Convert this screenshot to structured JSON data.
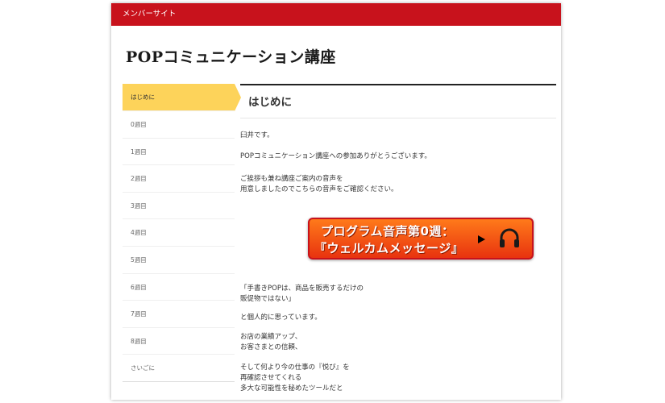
{
  "topbar": {
    "label": "メンバーサイト"
  },
  "site": {
    "title": "POPコミュニケーション講座"
  },
  "sidebar": {
    "items": [
      {
        "label": "はじめに"
      },
      {
        "label": "0週目"
      },
      {
        "label": "1週目"
      },
      {
        "label": "2週目"
      },
      {
        "label": "3週目"
      },
      {
        "label": "4週目"
      },
      {
        "label": "5週目"
      },
      {
        "label": "6週目"
      },
      {
        "label": "7週目"
      },
      {
        "label": "8週目"
      },
      {
        "label": "さいごに"
      }
    ]
  },
  "content": {
    "heading": "はじめに",
    "p1": "臼井です。",
    "p2": "POPコミュニケーション講座への参加ありがとうございます。",
    "p3a": "ご挨拶も兼ね講座ご案内の音声を",
    "p3b": "用意しましたのでこちらの音声をご確認ください。",
    "banner": {
      "line1": "プログラム音声第0週：",
      "line2": "『ウェルカムメッセージ』",
      "icons": [
        "play-icon",
        "headphone-icon"
      ]
    },
    "p4a": "「手書きPOPは、商品を販売するだけの",
    "p4b": "販促物ではない」",
    "p5": "と個人的に思っています。",
    "p6a": "お店の業績アップ、",
    "p6b": "お客さまとの信頼、",
    "p7a": "そして何より今の仕事の『悦び』を",
    "p7b": "再確認させてくれる",
    "p7c": "多大な可能性を秘めたツールだと"
  }
}
